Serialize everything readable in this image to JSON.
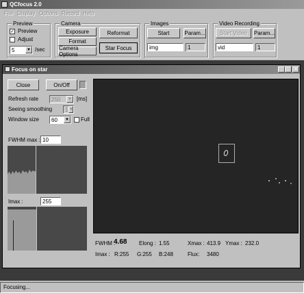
{
  "app": {
    "title": "QCfocus 2.0"
  },
  "menu": [
    "File",
    "Display",
    "Options",
    "Record",
    "Help"
  ],
  "preview": {
    "group": "Preview",
    "preview_label": "Preview",
    "adjust_label": "Adjust",
    "fps_value": "5",
    "fps_unit": "/sec",
    "preview_checked": true,
    "adjust_checked": false
  },
  "camera": {
    "group": "Camera",
    "exposure": "Exposure",
    "format": "Format",
    "options": "Camera Options",
    "reformat": "Reformat",
    "star_focus": "Star Focus"
  },
  "images": {
    "group": "Images",
    "start": "Start",
    "param": "Param...",
    "name": "img",
    "count": "1"
  },
  "video": {
    "group": "Video Recording",
    "start": "Start Video",
    "param": "Param...",
    "name": "vid",
    "count": "1"
  },
  "focus": {
    "title": "Focus on star",
    "close": "Close",
    "onoff": "On/Off",
    "refresh_label": "Refresh rate",
    "refresh_value": "250",
    "refresh_unit": "[ms]",
    "smoothing_label": "Seeing smoothing",
    "smoothing_value": "1",
    "window_label": "Window size",
    "window_value": "60",
    "full_label": "Full",
    "fwhm_max_label": "FWHM max :",
    "fwhm_max_value": "10",
    "imax_label": "Imax :",
    "imax_value": "255",
    "stats": {
      "fwhm_label": "FWHM :",
      "fwhm_value": "4.68",
      "elong_label": "Elong :",
      "elong_value": "1.55",
      "xmax_label": "Xmax :",
      "xmax_value": "413.9",
      "ymax_label": "Ymax :",
      "ymax_value": "232.0",
      "imax_label": "Imax :",
      "r_value": "R:255",
      "g_value": "G:255",
      "b_value": "B:248",
      "flux_label": "Flux:",
      "flux_value": "3480"
    }
  },
  "status": {
    "text": "Focusing..."
  }
}
